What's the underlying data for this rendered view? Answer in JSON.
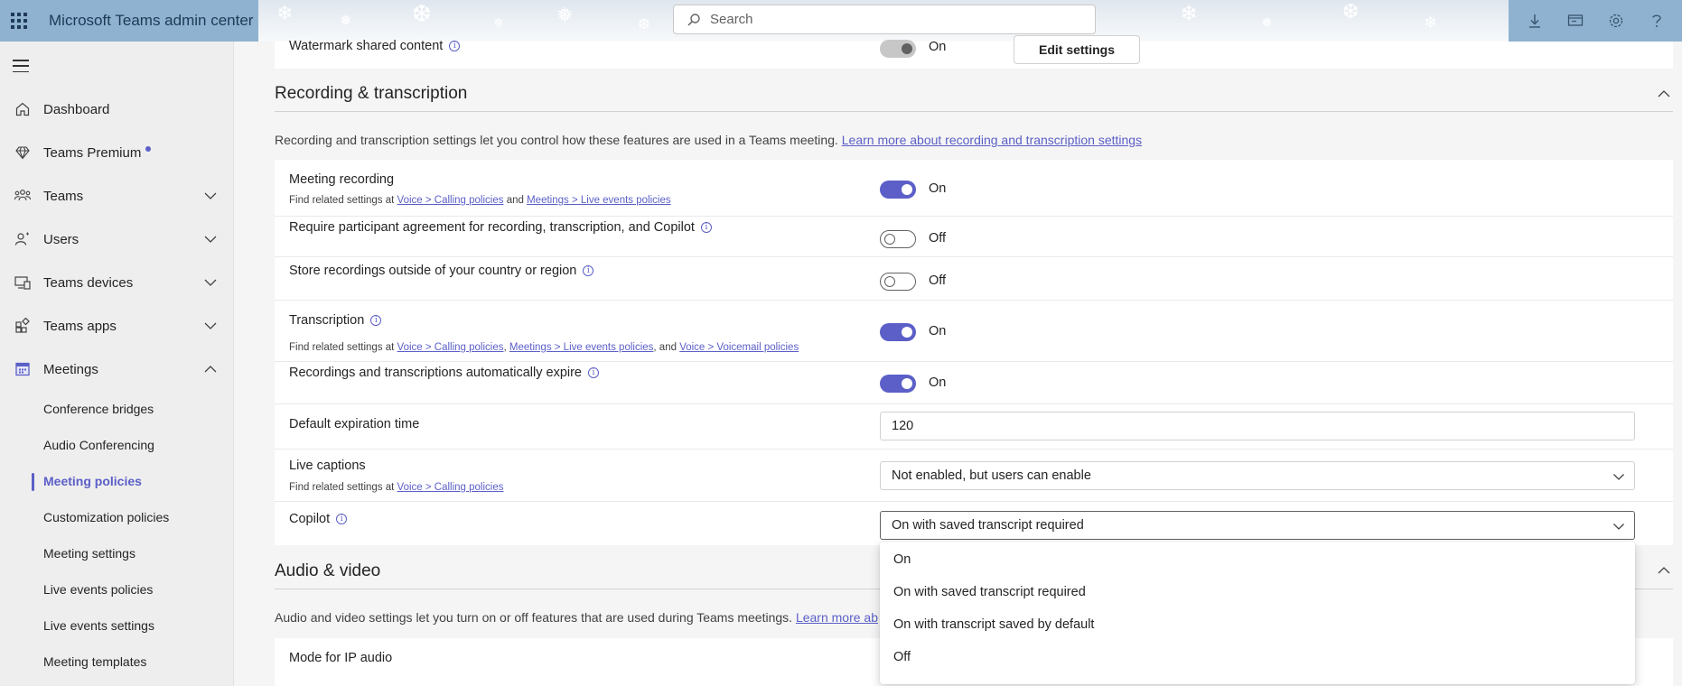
{
  "topbar": {
    "app_title": "Microsoft Teams admin center",
    "search_placeholder": "Search",
    "icons": [
      "download-icon",
      "screen-icon",
      "settings-icon",
      "help-icon"
    ]
  },
  "sidebar": {
    "items": [
      {
        "label": "Dashboard",
        "icon": "home-icon"
      },
      {
        "label": "Teams Premium",
        "icon": "diamond-icon"
      },
      {
        "label": "Teams",
        "icon": "teams-icon"
      },
      {
        "label": "Users",
        "icon": "users-icon"
      },
      {
        "label": "Teams devices",
        "icon": "devices-icon"
      },
      {
        "label": "Teams apps",
        "icon": "apps-icon"
      },
      {
        "label": "Meetings",
        "icon": "calendar-icon"
      }
    ],
    "meetings_sub": [
      "Conference bridges",
      "Audio Conferencing",
      "Meeting policies",
      "Customization policies",
      "Meeting settings",
      "Live events policies",
      "Live events settings",
      "Meeting templates"
    ]
  },
  "watermark": {
    "label": "Watermark shared content",
    "state": "On",
    "button": "Edit settings"
  },
  "recording": {
    "title": "Recording & transcription",
    "desc": "Recording and transcription settings let you control how these features are used in a Teams meeting.",
    "desc_link": "Learn more about recording and transcription settings",
    "meeting_recording": {
      "label": "Meeting recording",
      "sub_prefix": "Find related settings at",
      "link1": "Voice > Calling policies",
      "and": "and",
      "link2": "Meetings > Live events policies",
      "state": "On"
    },
    "participant_agreement": {
      "label": "Require participant agreement for recording, transcription, and Copilot",
      "state": "Off"
    },
    "store_outside": {
      "label": "Store recordings outside of your country or region",
      "state": "Off"
    },
    "transcription": {
      "label": "Transcription",
      "sub_prefix": "Find related settings at",
      "link1": "Voice > Calling policies",
      "comma": ",",
      "link2": "Meetings > Live events policies",
      "and": ", and",
      "link3": "Voice > Voicemail policies",
      "state": "On"
    },
    "auto_expire": {
      "label": "Recordings and transcriptions automatically expire",
      "state": "On"
    },
    "expiration": {
      "label": "Default expiration time",
      "value": "120"
    },
    "live_captions": {
      "label": "Live captions",
      "sub_prefix": "Find related settings at",
      "link1": "Voice > Calling policies",
      "value": "Not enabled, but users can enable"
    },
    "copilot": {
      "label": "Copilot",
      "value": "On with saved transcript required",
      "options": [
        "On",
        "On with saved transcript required",
        "On with transcript saved by default",
        "Off"
      ]
    }
  },
  "audio_video": {
    "title": "Audio & video",
    "desc": "Audio and video settings let you turn on or off features that are used during Teams meetings.",
    "desc_link": "Learn more ab",
    "mode_ip_audio": "Mode for IP audio"
  }
}
